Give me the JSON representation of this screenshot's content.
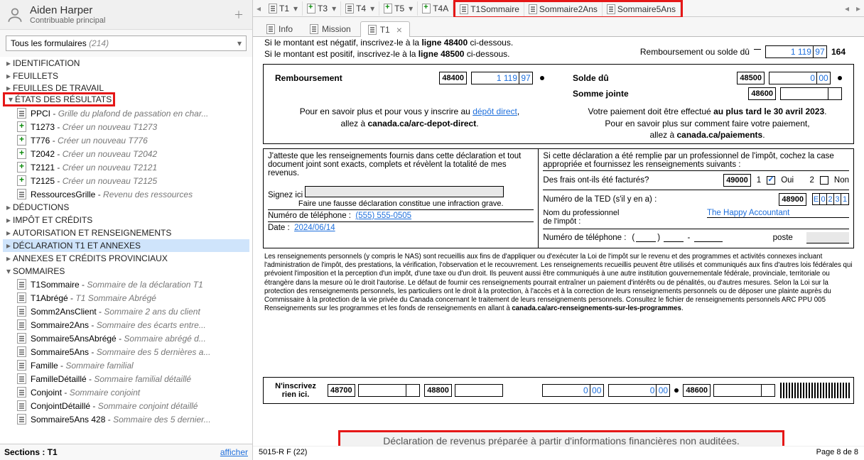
{
  "user": {
    "name": "Aiden Harper",
    "role": "Contribuable principal"
  },
  "formDropdown": {
    "label": "Tous les formulaires",
    "count": "(214)"
  },
  "categories": {
    "ident": "IDENTIFICATION",
    "feuillets": "FEUILLETS",
    "feuilles": "FEUILLES DE TRAVAIL",
    "etats": "ÉTATS DES RÉSULTATS",
    "deductions": "DÉDUCTIONS",
    "impot": "IMPÔT ET CRÉDITS",
    "auth": "AUTORISATION ET RENSEIGNEMENTS",
    "t1annex": "DÉCLARATION T1 ET ANNEXES",
    "prov": "ANNEXES ET CRÉDITS PROVINCIAUX",
    "somm": "SOMMAIRES"
  },
  "etatsItems": [
    {
      "code": "PPCI",
      "desc": "Grille du plafond de passation en char..."
    },
    {
      "code": "T1273",
      "desc": "Créer un nouveau T1273"
    },
    {
      "code": "T776",
      "desc": "Créer un nouveau T776"
    },
    {
      "code": "T2042",
      "desc": "Créer un nouveau T2042"
    },
    {
      "code": "T2121",
      "desc": "Créer un nouveau T2121"
    },
    {
      "code": "T2125",
      "desc": "Créer un nouveau T2125"
    },
    {
      "code": "RessourcesGrille",
      "desc": "Revenu des ressources"
    }
  ],
  "sommItems": [
    {
      "code": "T1Sommaire",
      "desc": "Sommaire de la déclaration T1"
    },
    {
      "code": "T1Abrégé",
      "desc": "T1 Sommaire Abrégé"
    },
    {
      "code": "Somm2AnsClient",
      "desc": "Sommaire 2 ans du client"
    },
    {
      "code": "Sommaire2Ans",
      "desc": "Sommaire des écarts entre..."
    },
    {
      "code": "Sommaire5AnsAbrégé",
      "desc": "Sommaire abrégé d..."
    },
    {
      "code": "Sommaire5Ans",
      "desc": "Sommaire des 5 dernières a..."
    },
    {
      "code": "Famille",
      "desc": "Sommaire familial"
    },
    {
      "code": "FamilleDétaillé",
      "desc": "Sommaire familial détaillé"
    },
    {
      "code": "Conjoint",
      "desc": "Sommaire conjoint"
    },
    {
      "code": "ConjointDétaillé",
      "desc": "Sommaire conjoint détaillé"
    },
    {
      "code": "Sommaire5Ans 428",
      "desc": "Sommaire des 5 dernier..."
    }
  ],
  "bottomBar": {
    "section": "Sections : T1",
    "display": "afficher"
  },
  "topTabs": {
    "t1": "T1",
    "t3": "T3",
    "t4": "T4",
    "t5": "T5",
    "t4a": "T4A",
    "s1": "T1Sommaire",
    "s2": "Sommaire2Ans",
    "s3": "Sommaire5Ans"
  },
  "subTabs": {
    "info": "Info",
    "mission": "Mission",
    "t1": "T1"
  },
  "doc": {
    "negLine": "Si le montant est négatif, inscrivez-le à la ",
    "negBold": "ligne 48400",
    "negAfter": " ci-dessous.",
    "posLine": "Si le montant est positif, inscrivez-le à la ",
    "posBold": "ligne 48500",
    "posAfter": " ci-dessous.",
    "refundOrBal": "Remboursement",
    "orBal": " ou solde dû",
    "totalInt": "1 119",
    "totalDec": "97",
    "totalTag": "164",
    "refundLbl": "Remboursement",
    "r48400": "48400",
    "rInt": "1 119",
    "rDec": "97",
    "soldLbl": "Solde dû",
    "s48500": "48500",
    "sInt": "0",
    "sDec": "00",
    "sommeLbl": "Somme jointe",
    "b48600": "48600",
    "leftNote1a": "Pour en savoir plus et pour vous y inscrire au ",
    "leftNote1link": "dépôt direct",
    "leftNote1b": ",",
    "leftNote2a": "allez à ",
    "leftNote2b": "canada.ca/arc-depot-direct",
    "leftNote2c": ".",
    "rightNote1a": "Votre paiement doit être effectué ",
    "rightNote1b": "au plus tard le 30 avril 2023",
    "rightNote1c": ".",
    "rightNote2": "Pour en savoir plus sur comment faire votre paiement,",
    "rightNote3a": "allez à ",
    "rightNote3b": "canada.ca/paiements",
    "rightNote3c": ".",
    "attest": "J'atteste que les renseignements fournis dans cette déclaration et tout document joint sont exacts, complets et révèlent la totalité de mes revenus.",
    "signLbl": "Signez ici",
    "fausse": "Faire une fausse déclaration constitue une infraction grave.",
    "telLbl": "Numéro de téléphone :",
    "telVal": "(555) 555-0505",
    "dateLbl": "Date :",
    "dateVal": "2024/06/14",
    "proIntro": "Si cette déclaration a été remplie par un professionnel de l'impôt, cochez la case appropriée et fournissez les renseignements suivants :",
    "fraisLbl": "Des frais ont-ils été facturés?",
    "b49000": "49000",
    "oui1": "1",
    "oui": "Oui",
    "non2": "2",
    "non": "Non",
    "tedLbl": "Numéro de la TED (s'il y en a) :",
    "b48900": "48900",
    "ted": {
      "c1": "E",
      "c2": "0",
      "c3": "2",
      "c4": "3",
      "c5": "1"
    },
    "profNameLbl": "Nom du professionnel\nde l'impôt :",
    "profName": "The Happy Accountant",
    "profTelLbl": "Numéro de téléphone :",
    "posteLbl": "poste",
    "fineprint": "Les renseignements personnels (y compris le NAS) sont recueillis aux fins de d'appliquer ou d'exécuter la Loi de l'impôt sur le revenu et des programmes et activités connexes incluant l'administration de l'impôt, des prestations, la vérification, l'observation et le recouvrement. Les renseignements recueillis peuvent être utilisés et communiqués aux fins d'autres lois fédérales qui prévoient l'imposition et la perception d'un impôt, d'une taxe ou d'un droit. Ils peuvent aussi être communiqués à une autre institution gouvernementale fédérale, provinciale, territoriale ou étrangère dans la mesure où le droit l'autorise. Le défaut de fournir ces renseignements pourrait entraîner un paiement d'intérêts ou de pénalités, ou d'autres mesures. Selon la Loi sur la protection des renseignements personnels, les particuliers ont le droit à la protection, à l'accès et à la correction de leurs renseignements personnels ou de déposer une plainte auprès du Commissaire à la protection de la vie privée du Canada concernant le traitement de leurs renseignements personnels. Consultez le fichier de renseignements personnels ARC PPU 005 Renseignements sur les programmes et les fonds de renseignements en allant à ",
    "fineprintBold": "canada.ca/arc-renseignements-sur-les-programmes",
    "noInscr1": "N'inscrivez",
    "noInscr2": "rien ici.",
    "b48700": "48700",
    "b48800": "48800",
    "zeroInt": "0",
    "zeroDec": "00",
    "final48600": "48600",
    "overlay": "Déclaration de revenus préparée à partir d'informations financières non auditées.",
    "formRef": "5015-R F (22)",
    "pageRef": "Page 8 de 8"
  }
}
